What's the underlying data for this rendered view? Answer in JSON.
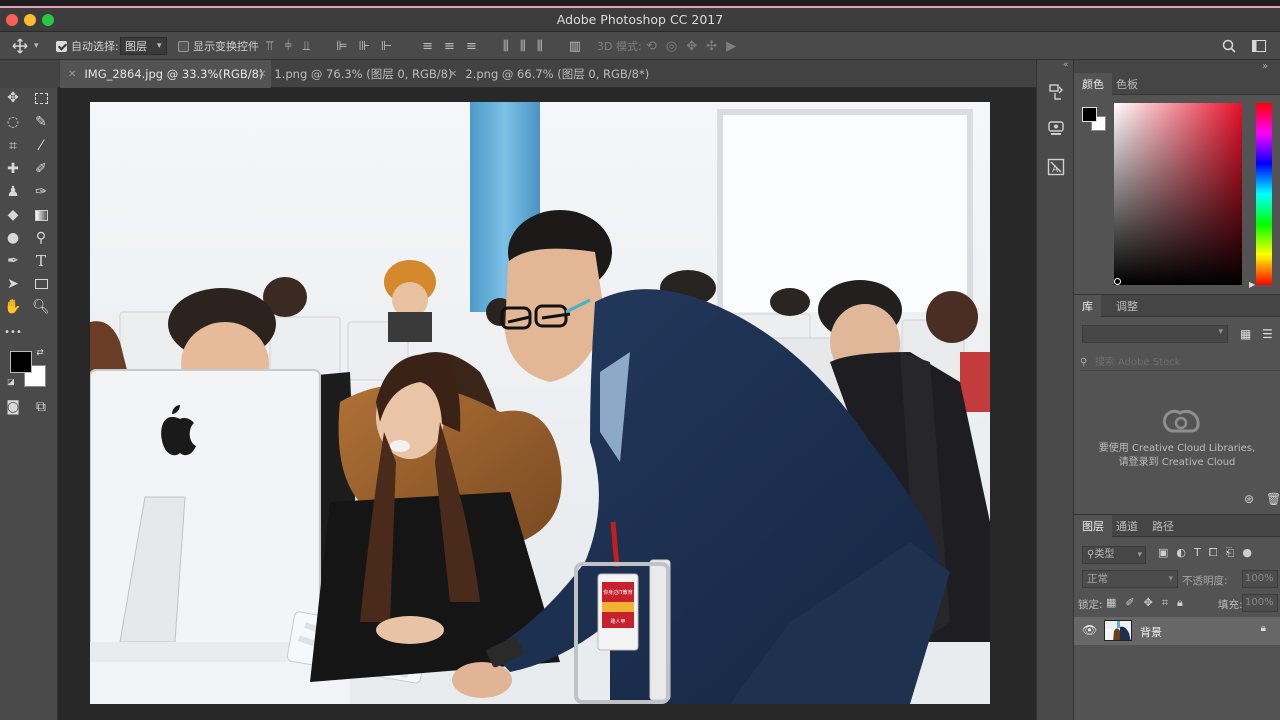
{
  "app_title": "Adobe Photoshop CC 2017",
  "options_bar": {
    "auto_select_label": "自动选择:",
    "auto_select_target": "图层",
    "show_transform_label": "显示变换控件",
    "mode_3d_label": "3D 模式:"
  },
  "tabs": [
    {
      "label": "IMG_2864.jpg @ 33.3%(RGB/8)",
      "active": true
    },
    {
      "label": "1.png @ 76.3% (图层 0, RGB/8)",
      "active": false
    },
    {
      "label": "2.png @ 66.7% (图层 0, RGB/8*)",
      "active": false
    }
  ],
  "color_panel": {
    "tabs": [
      "颜色",
      "色板"
    ],
    "foreground": "#000000",
    "background": "#ffffff",
    "picker_hue": "#e8102a"
  },
  "library_panel": {
    "tabs": [
      "库",
      "调整"
    ],
    "search_placeholder": "搜索 Adobe Stock",
    "message_line1": "要使用 Creative Cloud Libraries,",
    "message_line2": "请登录到 Creative Cloud"
  },
  "layers_panel": {
    "tabs": [
      "图层",
      "通道",
      "路径"
    ],
    "filter_label": "类型",
    "blend_mode": "正常",
    "opacity_label": "不透明度:",
    "opacity_value": "100%",
    "lock_label": "锁定:",
    "fill_label": "填充:",
    "fill_value": "100%",
    "layers": [
      {
        "name": "背景",
        "visible": true,
        "locked": true
      }
    ]
  },
  "badge_text": {
    "line1": "你身边IT教育",
    "line2": "路人甲"
  }
}
